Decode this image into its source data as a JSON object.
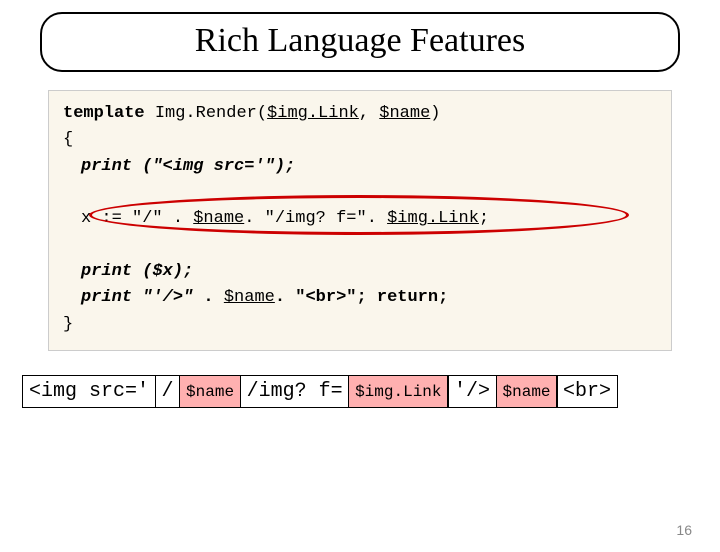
{
  "title": "Rich Language Features",
  "code": {
    "l1_kw": "template",
    "l1_name": " Img.Render(",
    "l1_p1": "$img.Link",
    "l1_sep": ", ",
    "l1_p2": "$name",
    "l1_close": ")",
    "l2": "{",
    "l3_fn": "print",
    "l3_rest": " (\"<img src='\");",
    "l5_a": "x := ",
    "l5_b": "\"/\"",
    "l5_c": " . ",
    "l5_d": "$name",
    "l5_e": ". ",
    "l5_f": "\"/img? f=\"",
    "l5_g": ". ",
    "l5_h": "$img.Link",
    "l5_i": ";",
    "l7_fn": "print",
    "l7_rest": " ($x);",
    "l8_fn": "print",
    "l8_a": " \"'/>\"",
    "l8_b": " . ",
    "l8_c": "$name",
    "l8_d": ". \"<br>\"; return;",
    "l9": "}"
  },
  "output": {
    "c1": "<img src='",
    "c2": "/",
    "c3": "$name",
    "c4": "/img? f=",
    "c5": "$img.Link",
    "c6": "'/>",
    "c7": "$name",
    "c8": "<br>"
  },
  "page": "16"
}
